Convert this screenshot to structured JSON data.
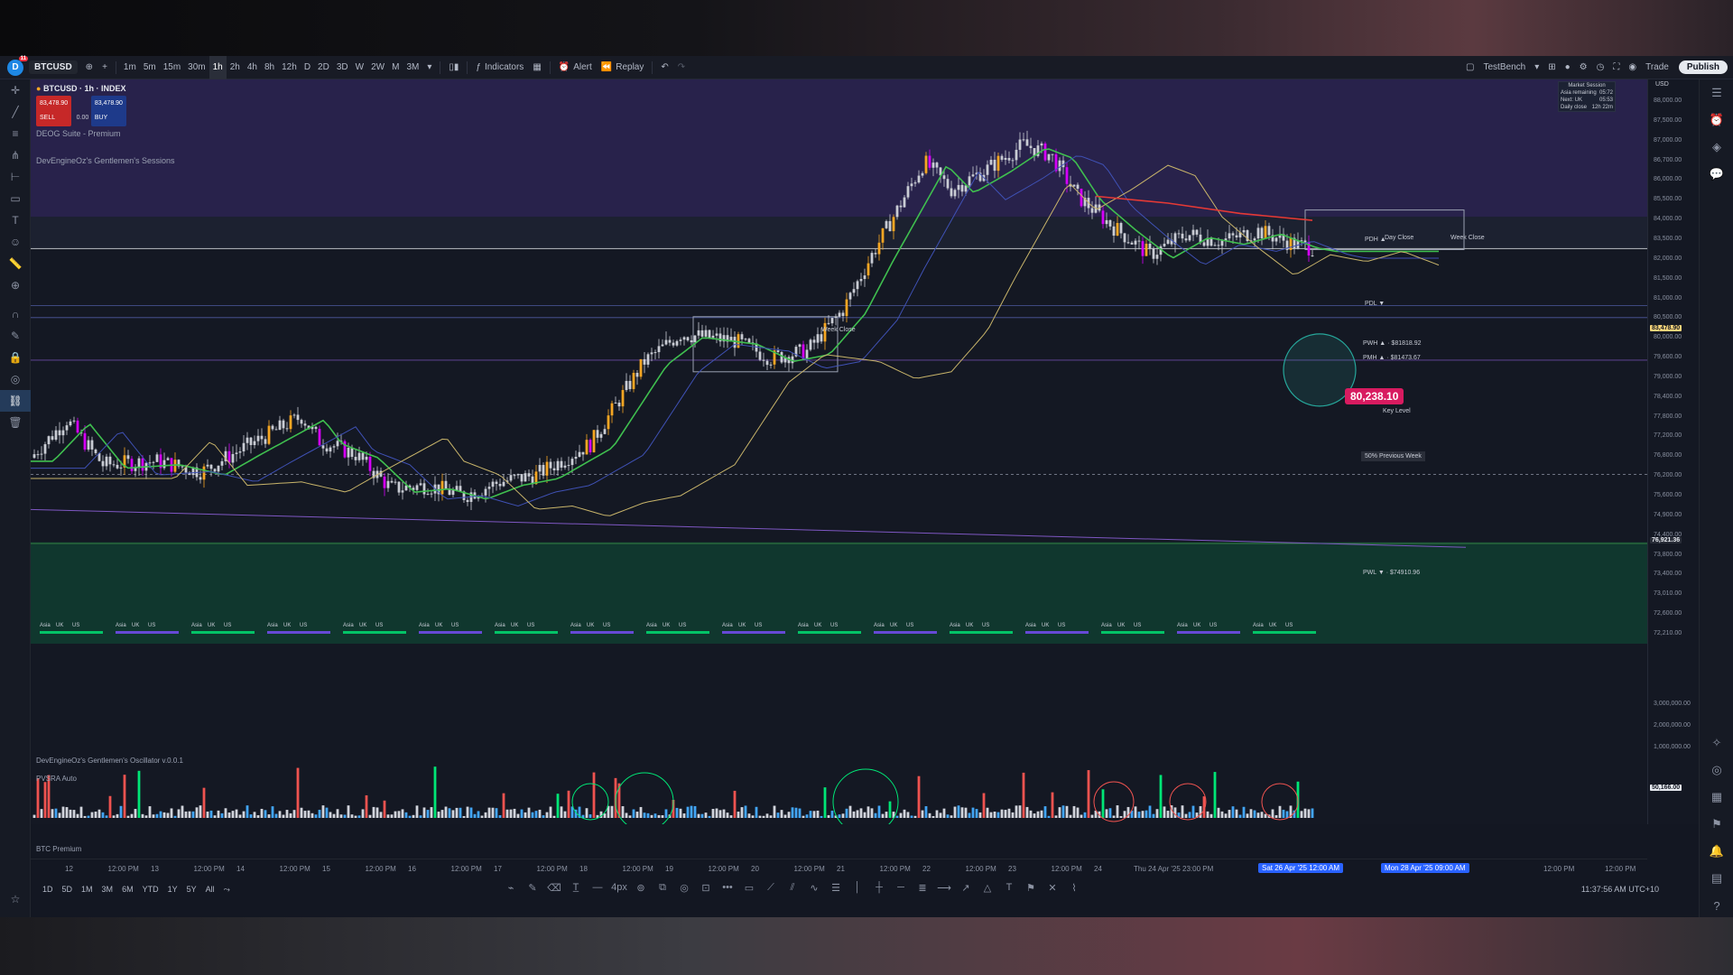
{
  "toolbar": {
    "logo_badge": "11",
    "symbol": "BTCUSD",
    "timeframes": [
      "1m",
      "5m",
      "15m",
      "30m",
      "1h",
      "2h",
      "4h",
      "8h",
      "12h",
      "D",
      "2D",
      "3D",
      "W",
      "2W",
      "M",
      "3M"
    ],
    "active_timeframe": "1h",
    "indicators_label": "Indicators",
    "alert_label": "Alert",
    "replay_label": "Replay",
    "layout_name": "TestBench",
    "trade_label": "Trade",
    "publish_label": "Publish"
  },
  "legend": {
    "title": "BTCUSD · 1h · INDEX",
    "sell_price": "83,478.90",
    "sell_label": "SELL",
    "spread": "0.00",
    "buy_price": "83,478.90",
    "buy_label": "BUY",
    "indicator1": "DEOG Suite - Premium",
    "indicator2": "DevEngineOz's Gentlemen's Sessions",
    "oscillator_title": "DevEngineOz's Gentlemen's Oscillator v.0.0.1",
    "pvsra_label": "PVSRA Auto",
    "btc_premium_label": "BTC Premium"
  },
  "sessions_panel": {
    "title": "Market Session",
    "rows": [
      {
        "label": "Asia remaining",
        "value": "05:72"
      },
      {
        "label": "Next: UK",
        "value": "05:53"
      },
      {
        "label": "Daily close",
        "value": "12h 22m"
      }
    ]
  },
  "annotations": {
    "week_close": "Week Close",
    "pdh": "PDH ▲",
    "day_close": "Day Close",
    "pdl": "PDL ▼",
    "pwh": "PWH ▲ · $81818.92",
    "pmh": "PMH ▲ · $81473.67",
    "pwl": "PWL ▼ · $74910.96",
    "key_level_price": "80,238.10",
    "key_level_label": "Key Level",
    "prev_week_50": "50% Previous Week",
    "session_tags": [
      "Asia",
      "UK",
      "US"
    ]
  },
  "price_axis": {
    "currency": "USD",
    "ticks": [
      "88,000.00",
      "87,500.00",
      "87,000.00",
      "86,700.00",
      "86,000.00",
      "85,500.00",
      "84,000.00",
      "83,500.00",
      "82,000.00",
      "81,500.00",
      "81,000.00",
      "80,500.00",
      "80,000.00",
      "79,600.00",
      "79,000.00",
      "78,400.00",
      "77,800.00",
      "77,200.00",
      "76,800.00",
      "76,200.00",
      "75,600.00",
      "74,900.00",
      "74,400.00",
      "73,800.00",
      "73,400.00",
      "73,010.00",
      "72,600.00",
      "72,210.00"
    ],
    "current_price": "83,478.90",
    "current_label": "BTCUSD",
    "crosshair_price": "76,921.36",
    "osc_ticks": [
      "3,000,000.00",
      "2,000,000.00",
      "1,000,000.00",
      "50,166.00"
    ]
  },
  "time_axis": {
    "labels": [
      "12",
      "12:00 PM",
      "13",
      "12:00 PM",
      "14",
      "12:00 PM",
      "15",
      "12:00 PM",
      "16",
      "12:00 PM",
      "17",
      "12:00 PM",
      "18",
      "12:00 PM",
      "19",
      "12:00 PM",
      "20",
      "12:00 PM",
      "21",
      "12:00 PM",
      "22",
      "12:00 PM",
      "23",
      "12:00 PM",
      "24"
    ],
    "highlight1": "Thu 24 Apr '25  23:00 PM",
    "highlight2": "Sat 26 Apr '25  12:00 AM",
    "highlight3": "Mon 28 Apr '25  09:00 AM",
    "tail": [
      "12:00 PM",
      "12:00 PM"
    ]
  },
  "bottom": {
    "ranges": [
      "1D",
      "5D",
      "1M",
      "3M",
      "6M",
      "YTD",
      "1Y",
      "5Y",
      "All"
    ],
    "clock": "11:37:56 AM UTC+10"
  },
  "colors": {
    "bull": "#f5a623",
    "bear": "#d500f9",
    "neutral": "#c9ccd4",
    "ema_green": "#3fbf4f",
    "ema_red": "#e53935",
    "ema_yellow": "#c8b46a",
    "ema_blue": "#3f51b5",
    "key_level": "#d81b60",
    "upper_zone": "#2a2350",
    "lower_zone": "#0f3b30"
  },
  "chart_data": {
    "type": "candlestick",
    "title": "BTCUSD · 1h · INDEX",
    "ylim": [
      72000,
      88000
    ],
    "x_range": [
      "12",
      "26"
    ],
    "levels": [
      {
        "name": "PWH",
        "value": 81818.92
      },
      {
        "name": "PMH",
        "value": 81473.67
      },
      {
        "name": "PWL",
        "value": 74910.96
      },
      {
        "name": "Key Level",
        "value": 80238.1
      },
      {
        "name": "Current",
        "value": 83478.9
      }
    ]
  }
}
